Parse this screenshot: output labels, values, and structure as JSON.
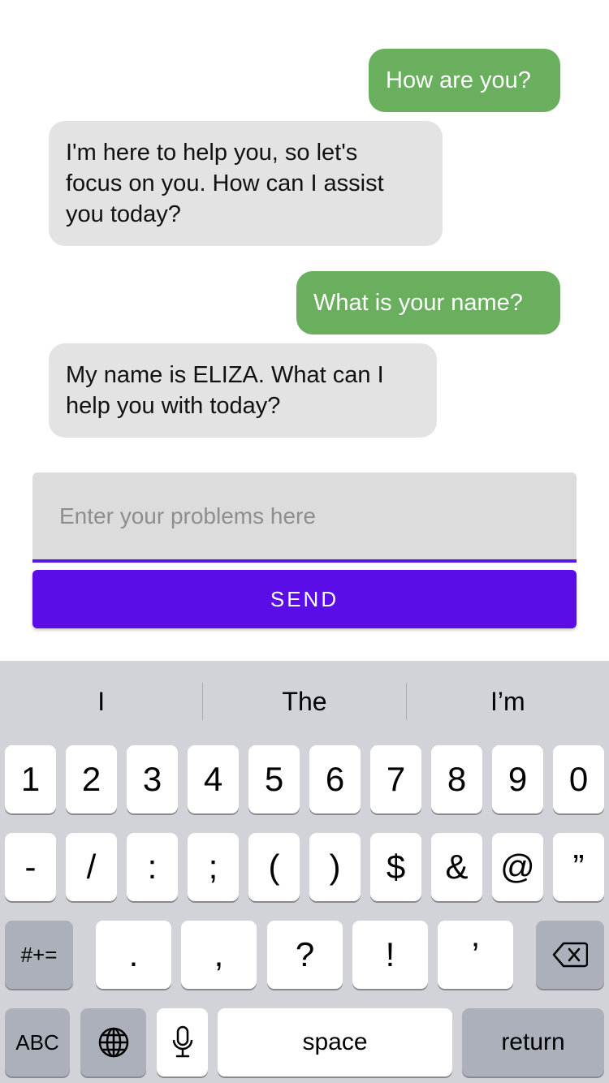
{
  "messages": [
    {
      "role": "user",
      "text": "How are you?"
    },
    {
      "role": "bot",
      "text": "I'm here to help you, so let's\nfocus on you. How can I assist\nyou today?"
    },
    {
      "role": "user",
      "text": "What is your name?"
    },
    {
      "role": "bot",
      "text": "My name is ELIZA. What can I\nhelp you with today?"
    }
  ],
  "input": {
    "placeholder": "Enter your problems here",
    "value": ""
  },
  "send_label": "SEND",
  "keyboard": {
    "suggestions": [
      "I",
      "The",
      "I’m"
    ],
    "row1": [
      "1",
      "2",
      "3",
      "4",
      "5",
      "6",
      "7",
      "8",
      "9",
      "0"
    ],
    "row2": [
      "-",
      "/",
      ":",
      ";",
      "(",
      ")",
      "$",
      "&",
      "@",
      "”"
    ],
    "row3": {
      "shift": "#+=",
      "keys": [
        ".",
        ",",
        "?",
        "!",
        "’"
      ],
      "delete_icon": "backspace-icon"
    },
    "row4": {
      "abc": "ABC",
      "globe_icon": "globe-icon",
      "mic_icon": "microphone-icon",
      "space": "space",
      "return": "return"
    }
  },
  "colors": {
    "user_bubble": "#6aaf5e",
    "bot_bubble": "#e3e3e3",
    "accent": "#5a0de6"
  }
}
